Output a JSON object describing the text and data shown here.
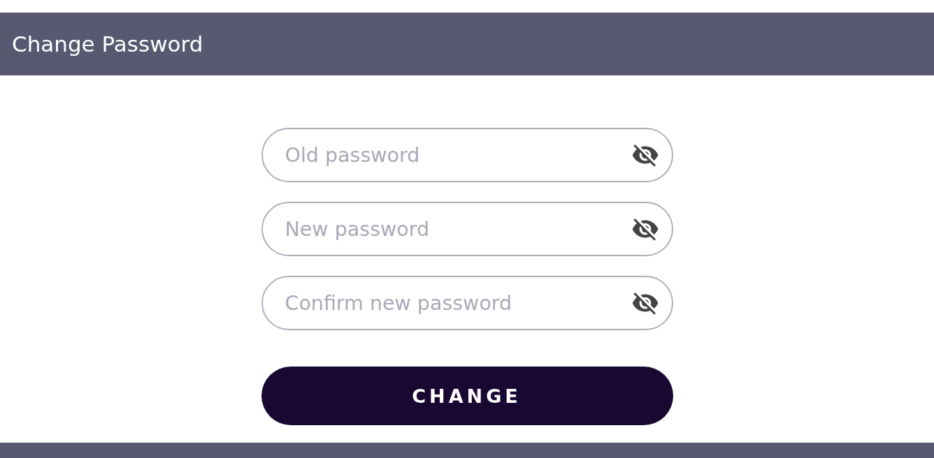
{
  "header": {
    "title": "Change Password"
  },
  "fields": [
    {
      "placeholder": "Old password",
      "password_visible": false
    },
    {
      "placeholder": "New password",
      "password_visible": false
    },
    {
      "placeholder": "Confirm new password",
      "password_visible": false
    }
  ],
  "submit_button": {
    "label": "CHANGE"
  }
}
